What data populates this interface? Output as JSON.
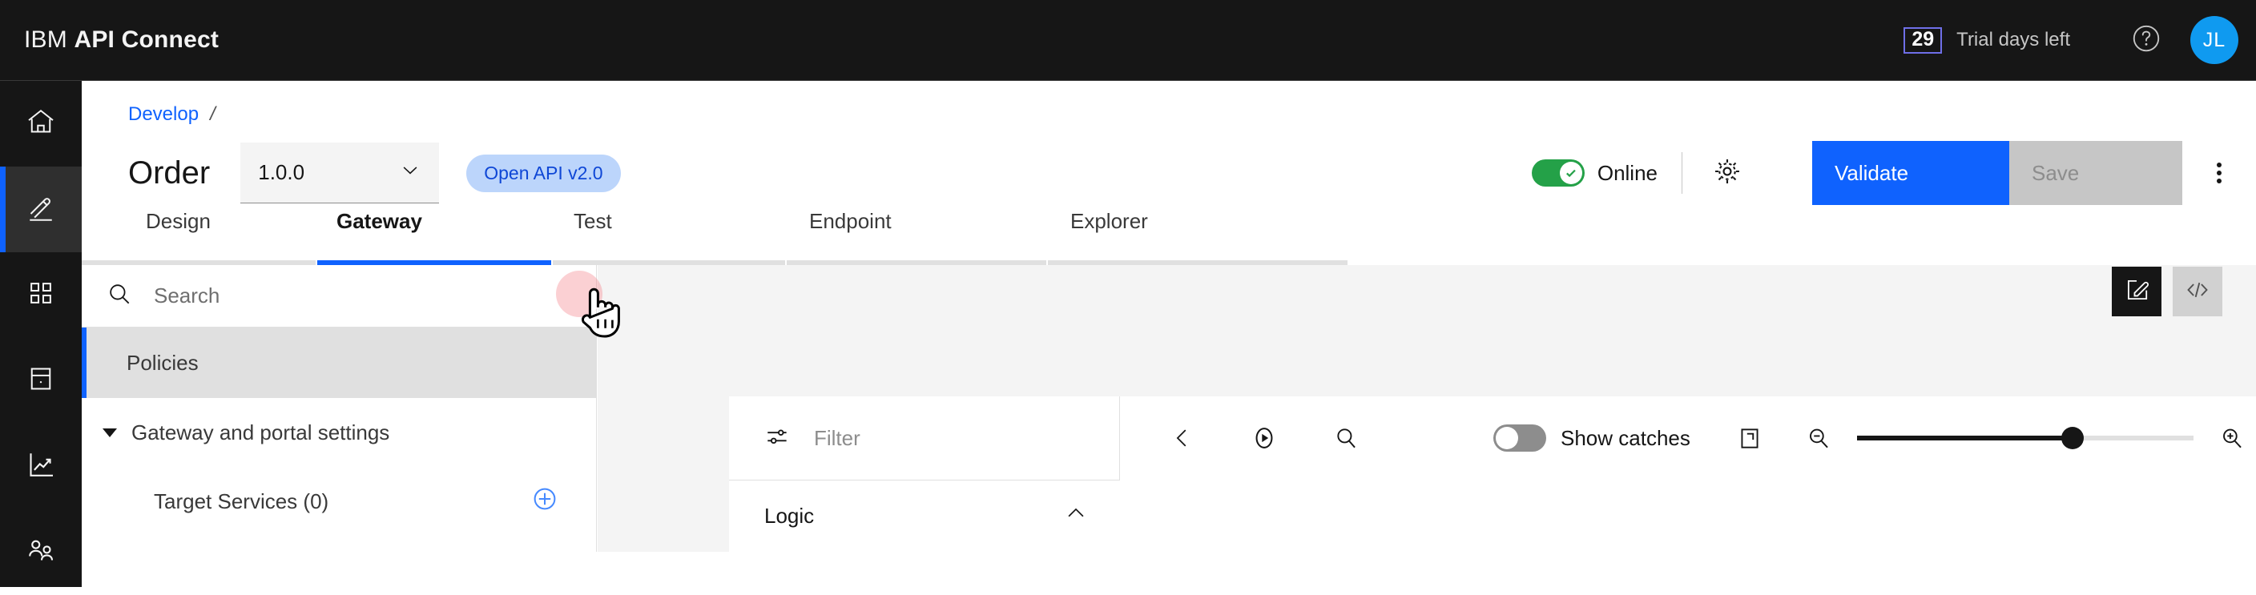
{
  "header": {
    "brand_prefix": "IBM",
    "brand_name": "API Connect",
    "trial_count": "29",
    "trial_label": "Trial days left",
    "help_icon": "help-circle-icon",
    "avatar_initials": "JL",
    "avatar_color": "#0f9af0",
    "background": "#161616"
  },
  "rail": {
    "items": [
      {
        "icon": "home-icon",
        "name": "home",
        "active": false
      },
      {
        "icon": "pencil-icon",
        "name": "develop",
        "active": true
      },
      {
        "icon": "grid-apps-icon",
        "name": "manage",
        "active": false
      },
      {
        "icon": "catalog-icon",
        "name": "catalog",
        "active": false
      },
      {
        "icon": "analytics-chart-icon",
        "name": "analytics",
        "active": false
      },
      {
        "icon": "users-icon",
        "name": "members",
        "active": false
      }
    ],
    "active_accent": "#0f62fe"
  },
  "breadcrumb": {
    "items": [
      "Develop"
    ],
    "separator": "/",
    "link_color": "#0f62fe"
  },
  "title_row": {
    "api_title": "Order",
    "version_value": "1.0.0",
    "version_chevron": "chevron-down-icon",
    "badge_label": "Open API v2.0",
    "badge_bg": "#bcd5fb",
    "badge_fg": "#0f47d6",
    "status_label": "Online",
    "status_toggle_on": true,
    "status_color": "#24a148",
    "gear_icon": "gear-icon",
    "validate_label": "Validate",
    "validate_color": "#0f62fe",
    "save_label": "Save",
    "save_disabled": true,
    "kebab_icon": "overflow-menu-icon"
  },
  "tabs": {
    "items": [
      {
        "label": "Design",
        "active": false
      },
      {
        "label": "Gateway",
        "active": true
      },
      {
        "label": "Test",
        "active": false
      },
      {
        "label": "Endpoint",
        "active": false
      },
      {
        "label": "Explorer",
        "active": false
      }
    ],
    "active_underline": "#0f62fe"
  },
  "left_panel": {
    "search_placeholder": "Search",
    "search_icon": "search-icon",
    "selected_item": "Policies",
    "group_label": "Gateway and portal settings",
    "group_caret": "caret-down-icon",
    "tree_items": [
      {
        "label": "Target Services (0)",
        "action_icon": "add-circle-icon"
      }
    ]
  },
  "canvas": {
    "background": "#f4f4f4",
    "tools": [
      {
        "icon": "edit-document-icon",
        "name": "edit-view",
        "active": true
      },
      {
        "icon": "source-code-icon",
        "name": "source-view",
        "active": false
      }
    ],
    "flow_toolbar": {
      "filter_icon": "sliders-icon",
      "filter_placeholder": "Filter",
      "back_icon": "chevron-left-icon",
      "play_icon": "play-circle-icon",
      "search_icon": "search-icon",
      "show_catches_label": "Show catches",
      "show_catches_on": false,
      "fit_icon": "fit-to-screen-icon",
      "zoom_out_icon": "zoom-out-icon",
      "zoom_in_icon": "zoom-in-icon",
      "zoom_value": 64
    },
    "palette": {
      "section_label": "Logic",
      "section_chevron": "chevron-up-icon",
      "expanded": true
    }
  },
  "pointer": {
    "cursor": "pointing-hand-cursor",
    "ripple_color": "rgba(244,120,130,0.35)"
  }
}
